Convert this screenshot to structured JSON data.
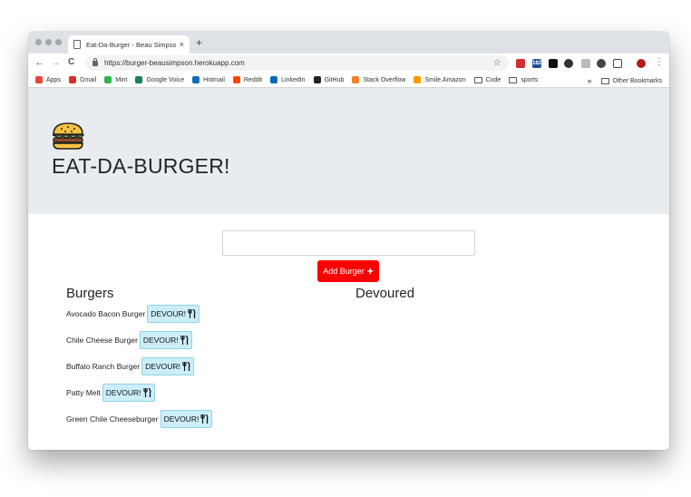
{
  "browser": {
    "tab_title": "Eat-Da-Burger - Beau Simpson",
    "tab_close": "×",
    "new_tab": "+",
    "url": "https://burger-beausimpson.herokuapp.com",
    "nav": {
      "back": "←",
      "forward": "→",
      "reload": "C",
      "star": "☆",
      "menu": "⋮"
    },
    "extension_badge": "182"
  },
  "bookmarks": {
    "items": [
      {
        "label": "Apps",
        "color": "#e8453c"
      },
      {
        "label": "Gmail",
        "color": "#d93025"
      },
      {
        "label": "Mint",
        "color": "#30b34a"
      },
      {
        "label": "Google Voice",
        "color": "#1a7f5a"
      },
      {
        "label": "Hotmail",
        "color": "#0f6cbd"
      },
      {
        "label": "Reddit",
        "color": "#ff4500"
      },
      {
        "label": "LinkedIn",
        "color": "#0a66c2"
      },
      {
        "label": "GitHub",
        "color": "#222222"
      },
      {
        "label": "Stack Overflow",
        "color": "#f48024"
      },
      {
        "label": "Smile.Amazon",
        "color": "#ff9900"
      },
      {
        "label": "Code",
        "color": "folder"
      },
      {
        "label": "sports",
        "color": "folder"
      }
    ],
    "overflow": "»",
    "other": "Other Bookmarks"
  },
  "page": {
    "title": "EAT-DA-BURGER!",
    "input_value": "",
    "add_button": "Add Burger",
    "add_button_icon": "+",
    "burgers_heading": "Burgers",
    "devoured_heading": "Devoured",
    "devour_label": "DEVOUR!",
    "burgers": [
      {
        "name": "Avocado Bacon Burger"
      },
      {
        "name": "Chile Cheese Burger"
      },
      {
        "name": "Buffalo Ranch Burger"
      },
      {
        "name": "Patty Melt"
      },
      {
        "name": "Green Chile Cheeseburger"
      }
    ],
    "colors": {
      "add_button": "#ff0000",
      "devour_button": "#cbeef9",
      "jumbotron": "#e9ecef"
    }
  }
}
